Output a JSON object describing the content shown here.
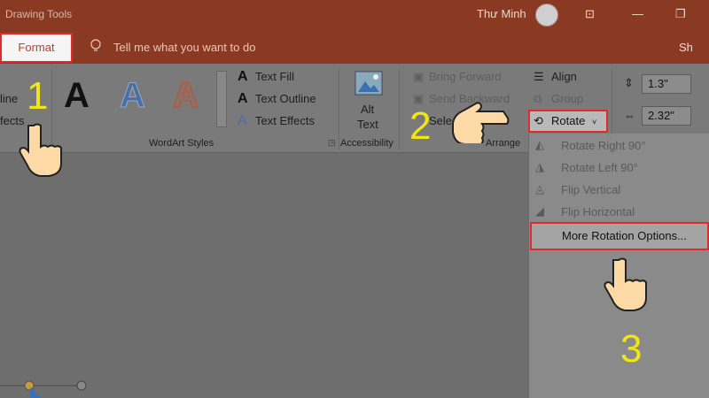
{
  "title_bar": {
    "context_label": "Drawing Tools",
    "user_name": "Thư Minh"
  },
  "tabs": {
    "format_label": "Format",
    "tell_me": "Tell me what you want to do",
    "share_label": "Sh"
  },
  "ribbon": {
    "left_partial_1": "line",
    "left_partial_2": "fects",
    "text_fill": "Text Fill",
    "text_outline": "Text Outline",
    "text_effects": "Text Effects",
    "wordart_group": "WordArt Styles",
    "alt_text_line1": "Alt",
    "alt_text_line2": "Text",
    "accessibility_group": "Accessibility",
    "bring_forward": "Bring Forward",
    "send_backward": "Send Backward",
    "selection_partial": "Selec",
    "arrange_group": "Arrange",
    "align": "Align",
    "group": "Group",
    "rotate": "Rotate",
    "height_value": "1.3\"",
    "width_value": "2.32\""
  },
  "rotate_menu": {
    "items": [
      "Rotate Right 90°",
      "Rotate Left 90°",
      "Flip Vertical",
      "Flip Horizontal"
    ],
    "more_options": "More Rotation Options..."
  },
  "steps": {
    "step1": "1",
    "step2": "2",
    "step3": "3"
  },
  "colors": {
    "title_bar": "#8a3a22",
    "highlight": "#e12a2a",
    "step_number": "#f2e514"
  }
}
